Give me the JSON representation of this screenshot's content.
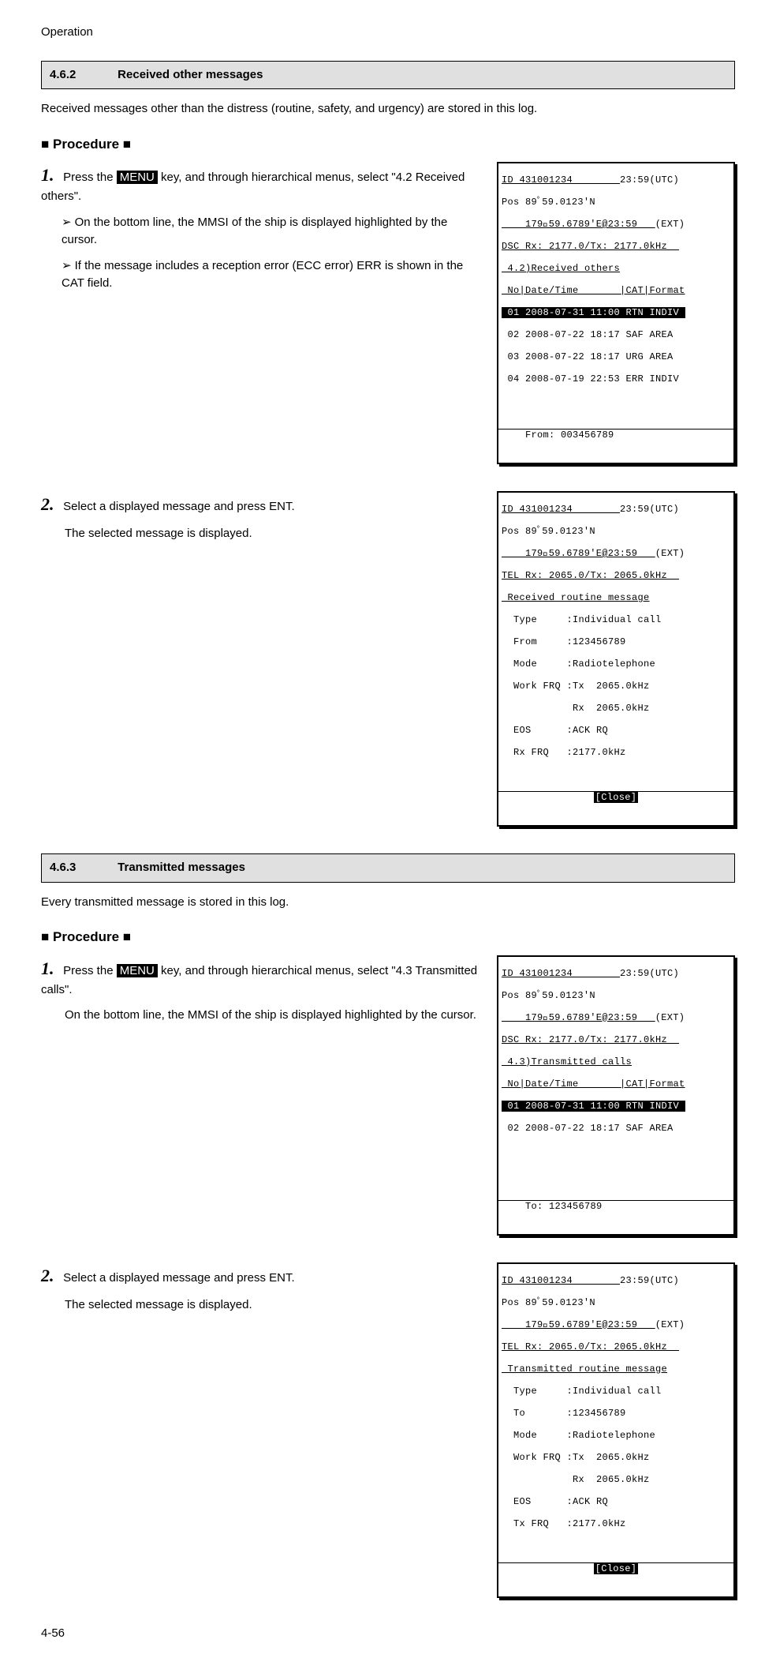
{
  "header": "Operation",
  "sec462": {
    "num": "4.6.2",
    "title": "Received other messages"
  },
  "para462": "Received messages other than the distress (routine, safety, and urgency) are stored in this log.",
  "proc_title": "■ Procedure ■",
  "s462_1a": "Press the ",
  "menu_key": "MENU",
  "s462_1b": " key, and through hierarchical menus, select \"4.2 Received others\".",
  "s462_1_sub1": "On the bottom line, the MMSI of the ship is displayed highlighted by the cursor.",
  "s462_1_sub2": "If the message includes a reception error (ECC error) ERR is shown in the CAT field.",
  "s462_2a": "Select a displayed message and press ENT.",
  "s462_2b": "The selected message is displayed.",
  "sec463": {
    "num": "4.6.3",
    "title": "Transmitted messages"
  },
  "para463": "Every transmitted message is stored in this log.",
  "s463_1a": " Press the ",
  "s463_1b": " key, and through hierarchical menus, select \"4.3 Transmitted calls\".",
  "s463_1_sub": "On the bottom line, the MMSI of the ship is displayed highlighted by the cursor.",
  "s463_2a": "Select a displayed message and press ENT.",
  "s463_2b": "The selected message is displayed.",
  "page_num": "4-56",
  "lcd1": {
    "l1a": "ID 431001234        ",
    "l1b": "23:59(UTC)",
    "l2": "Pos 89ﾟ59.0123'N",
    "l3a": "    179ﾟ59.6789'E@23:59   ",
    "l3b": "(EXT)",
    "l4": "DSC Rx: 2177.0/Tx: 2177.0kHz  ",
    "l5": " 4.2)Received others",
    "l6": " No|Date/Time       |CAT|Format",
    "l7": " 01 2008-07-31 11:00 RTN INDIV ",
    "l8": " 02 2008-07-22 18:17 SAF AREA",
    "l9": " 03 2008-07-22 18:17 URG AREA",
    "l10": " 04 2008-07-19 22:53 ERR INDIV",
    "foot": "    From: 003456789"
  },
  "lcd2": {
    "l1a": "ID 431001234        ",
    "l1b": "23:59(UTC)",
    "l2": "Pos 89ﾟ59.0123'N",
    "l3a": "    179ﾟ59.6789'E@23:59   ",
    "l3b": "(EXT)",
    "l4": "TEL Rx: 2065.0/Tx: 2065.0kHz  ",
    "l5": " Received routine message",
    "l6": "  Type     :Individual call",
    "l7": "  From     :123456789",
    "l8": "  Mode     :Radiotelephone",
    "l9": "  Work FRQ :Tx  2065.0kHz",
    "l10": "            Rx  2065.0kHz",
    "l11": "  EOS      :ACK RQ",
    "l12": "  Rx FRQ   :2177.0kHz",
    "btn": "[Close]"
  },
  "lcd3": {
    "l1a": "ID 431001234        ",
    "l1b": "23:59(UTC)",
    "l2": "Pos 89ﾟ59.0123'N",
    "l3a": "    179ﾟ59.6789'E@23:59   ",
    "l3b": "(EXT)",
    "l4": "DSC Rx: 2177.0/Tx: 2177.0kHz  ",
    "l5": " 4.3)Transmitted calls",
    "l6": " No|Date/Time       |CAT|Format",
    "l7": " 01 2008-07-31 11:00 RTN INDIV ",
    "l8": " 02 2008-07-22 18:17 SAF AREA",
    "foot": "    To: 123456789"
  },
  "lcd4": {
    "l1a": "ID 431001234        ",
    "l1b": "23:59(UTC)",
    "l2": "Pos 89ﾟ59.0123'N",
    "l3a": "    179ﾟ59.6789'E@23:59   ",
    "l3b": "(EXT)",
    "l4": "TEL Rx: 2065.0/Tx: 2065.0kHz  ",
    "l5": " Transmitted routine message",
    "l6": "  Type     :Individual call",
    "l7": "  To       :123456789",
    "l8": "  Mode     :Radiotelephone",
    "l9": "  Work FRQ :Tx  2065.0kHz",
    "l10": "            Rx  2065.0kHz",
    "l11": "  EOS      :ACK RQ",
    "l12": "  Tx FRQ   :2177.0kHz",
    "btn": "[Close]"
  }
}
